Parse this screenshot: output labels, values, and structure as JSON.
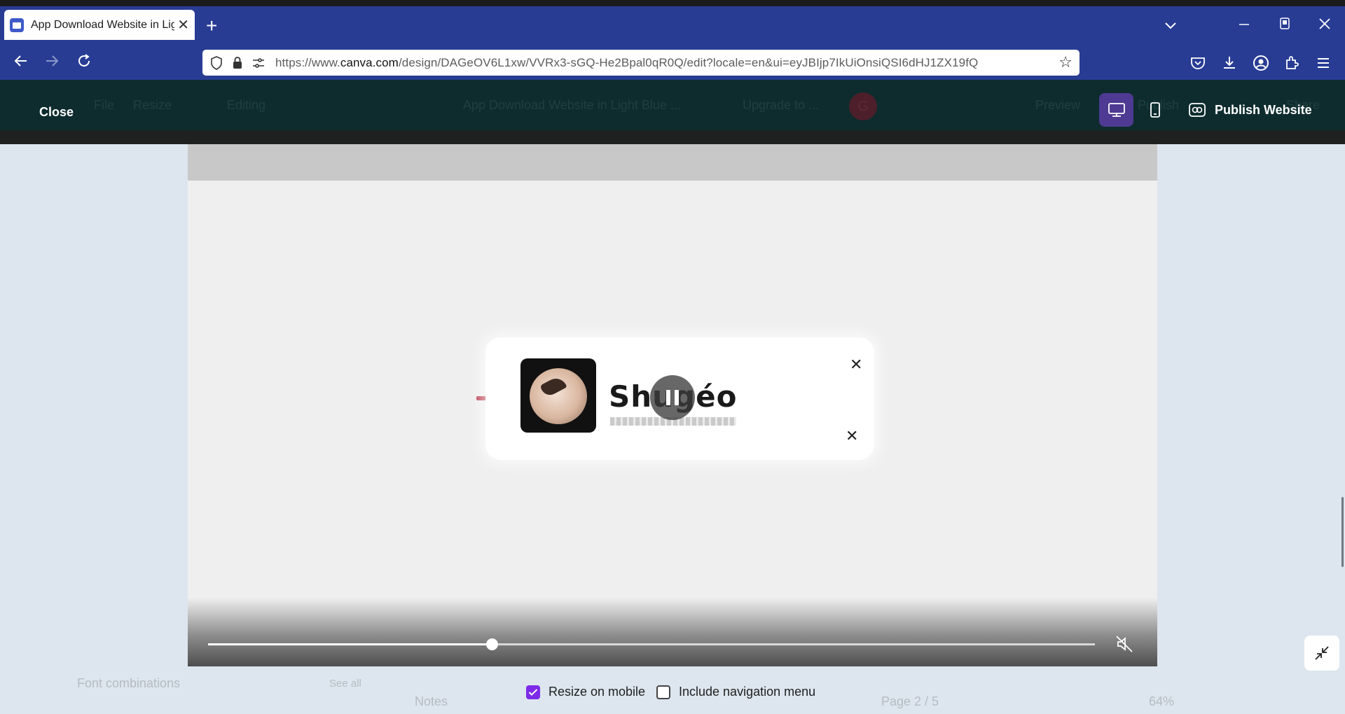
{
  "browser": {
    "tab_title": "App Download Website in Light Blue",
    "url_prefix": "https://www.",
    "url_domain": "canva.com",
    "url_rest": "/design/DAGeOV6L1xw/VVRx3-sGQ-He2Bpal0qR0Q/edit?locale=en&ui=eyJBIjp7IkUiOnsiQSI6dHJ1ZX19fQ"
  },
  "editor": {
    "close_label": "Close",
    "publish_label": "Publish Website",
    "background_items": {
      "file": "File",
      "resize": "Resize",
      "editing": "Editing",
      "doc_title": "App Download Website in Light Blue ...",
      "upgrade": "Upgrade to ...",
      "avatar_initial": "G",
      "preview": "Preview",
      "publish": "Publish",
      "share": "Share"
    }
  },
  "video": {
    "brand_text": "Shugéo",
    "progress": 0.32,
    "muted": true
  },
  "bottom": {
    "resize_on_mobile": {
      "label": "Resize on mobile",
      "checked": true
    },
    "include_nav_menu": {
      "label": "Include navigation menu",
      "checked": false
    },
    "background_items": {
      "font_combinations": "Font combinations",
      "see_all": "See all",
      "notes": "Notes",
      "page_indicator": "Page 2 / 5",
      "zoom": "64%"
    }
  },
  "colors": {
    "browser_chrome": "#283c94",
    "editor_bar": "#0e2c2e",
    "active_view": "#4e3a92",
    "checkbox_on": "#7d2ae8",
    "workspace": "#dde6ee"
  }
}
